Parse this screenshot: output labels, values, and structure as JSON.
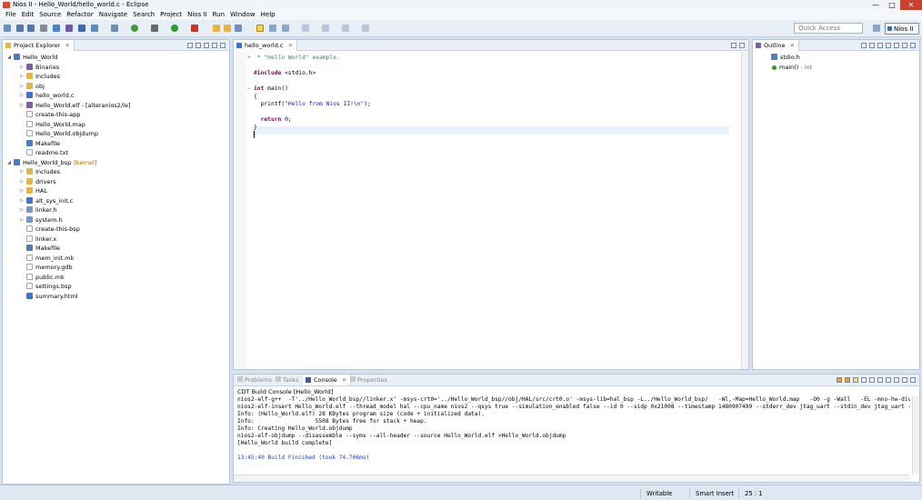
{
  "window": {
    "title": "Nios II - Hello_World/hello_world.c - Eclipse",
    "controls": {
      "minimize": "—",
      "maximize": "□",
      "close": "✕"
    }
  },
  "menu": [
    "File",
    "Edit",
    "Source",
    "Refactor",
    "Navigate",
    "Search",
    "Project",
    "Nios II",
    "Run",
    "Window",
    "Help"
  ],
  "toolbar": {
    "quick_access_placeholder": "Quick Access",
    "perspective_label": "Nios II"
  },
  "project_explorer": {
    "tab_label": "Project Explorer",
    "items": [
      {
        "label": "Hello_World",
        "level": 0,
        "expanded": true,
        "icon": "project-icon"
      },
      {
        "label": "Binaries",
        "level": 1,
        "icon": "binaries-icon"
      },
      {
        "label": "Includes",
        "level": 1,
        "icon": "includes-icon"
      },
      {
        "label": "obj",
        "level": 1,
        "icon": "folder-icon"
      },
      {
        "label": "hello_world.c",
        "level": 1,
        "icon": "c-file-icon"
      },
      {
        "label": "Hello_World.elf - [alteranios2/le]",
        "level": 1,
        "icon": "elf-icon"
      },
      {
        "label": "create-this-app",
        "level": 1,
        "icon": "file-icon"
      },
      {
        "label": "Hello_World.map",
        "level": 1,
        "icon": "file-icon"
      },
      {
        "label": "Hello_World.objdump",
        "level": 1,
        "icon": "file-icon"
      },
      {
        "label": "Makefile",
        "level": 1,
        "icon": "makefile-icon"
      },
      {
        "label": "readme.txt",
        "level": 1,
        "icon": "file-icon"
      },
      {
        "label": "Hello_World_bsp",
        "decoration": "[kernel]",
        "level": 0,
        "expanded": true,
        "icon": "project-icon"
      },
      {
        "label": "Includes",
        "level": 1,
        "icon": "includes-icon"
      },
      {
        "label": "drivers",
        "level": 1,
        "icon": "folder-icon"
      },
      {
        "label": "HAL",
        "level": 1,
        "icon": "folder-icon"
      },
      {
        "label": "alt_sys_init.c",
        "level": 1,
        "icon": "c-file-icon"
      },
      {
        "label": "linker.h",
        "level": 1,
        "icon": "h-file-icon"
      },
      {
        "label": "system.h",
        "level": 1,
        "icon": "h-file-icon"
      },
      {
        "label": "create-this-bsp",
        "level": 1,
        "icon": "file-icon"
      },
      {
        "label": "linker.x",
        "level": 1,
        "icon": "file-icon"
      },
      {
        "label": "Makefile",
        "level": 1,
        "icon": "makefile-icon"
      },
      {
        "label": "mem_init.mk",
        "level": 1,
        "icon": "file-icon"
      },
      {
        "label": "memory.gdb",
        "level": 1,
        "icon": "file-icon"
      },
      {
        "label": "public.mk",
        "level": 1,
        "icon": "file-icon"
      },
      {
        "label": "settings.bsp",
        "level": 1,
        "icon": "file-icon"
      },
      {
        "label": "summary.html",
        "level": 1,
        "icon": "html-file-icon"
      }
    ]
  },
  "editor": {
    "tab_label": "hello_world.c",
    "lines": [
      {
        "text": " * \"Hello World\" example.",
        "kind": "comment",
        "fold": "+"
      },
      {
        "text": "",
        "kind": "plain"
      },
      {
        "text": "#include <stdio.h>",
        "kind": "include"
      },
      {
        "text": "",
        "kind": "plain"
      },
      {
        "text": "int main()",
        "kind": "signature",
        "fold": "−"
      },
      {
        "text": "{",
        "kind": "plain"
      },
      {
        "text": "  printf(\"Hello from Nios II!\\n\");",
        "kind": "call"
      },
      {
        "text": "",
        "kind": "plain"
      },
      {
        "text": "  return 0;",
        "kind": "return"
      },
      {
        "text": "}",
        "kind": "plain"
      },
      {
        "text": "",
        "kind": "cursor"
      }
    ]
  },
  "outline": {
    "tab_label": "Outline",
    "items": [
      {
        "label": "stdio.h",
        "icon": "include-icon"
      },
      {
        "label": "main()",
        "suffix": ": int",
        "icon": "function-icon"
      }
    ]
  },
  "bottom_panel": {
    "tabs": [
      "Problems",
      "Tasks",
      "Console",
      "Properties"
    ],
    "active_tab": "Console",
    "console_title": "CDT Build Console [Hello_World]",
    "lines": [
      "nios2-elf-g++  -T'../Hello_World_bsp//linker.x' -msys-crt0='../Hello_World_bsp//obj/HAL/src/crt0.o' -msys-lib=hal_bsp -L../Hello_World_bsp/   -Wl,-Map=Hello_World.map   -O0 -g -Wall   -EL -mno-hw-div -mno",
      "nios2-elf-insert Hello_World.elf --thread_model hal --cpu_name nios2 --qsys true --simulation_enabled false --id 0 --sidp 0x21008 --timestamp 1480907499 --stderr_dev jtag_uart --stdin_dev jtag_uart --",
      "Info: (Hello_World.elf) 28 KBytes program size (code + initialized data).",
      "Info:                  5508 Bytes free for stack + heap.",
      "Info: Creating Hello_World.objdump",
      "nios2-elf-objdump --disassemble --syms --all-header --source Hello_World.elf >Hello_World.objdump",
      "[Hello_World build complete]",
      "",
      "13:45:40 Build Finished (took 74.706ms)"
    ]
  },
  "status": {
    "writable": "Writable",
    "insert_mode": "Smart Insert",
    "position": "25 : 1"
  },
  "colors": {
    "keyword": "#7f0055",
    "string": "#2a00ff",
    "comment": "#3f7f5f",
    "build_finished": "#1f3fbf"
  }
}
